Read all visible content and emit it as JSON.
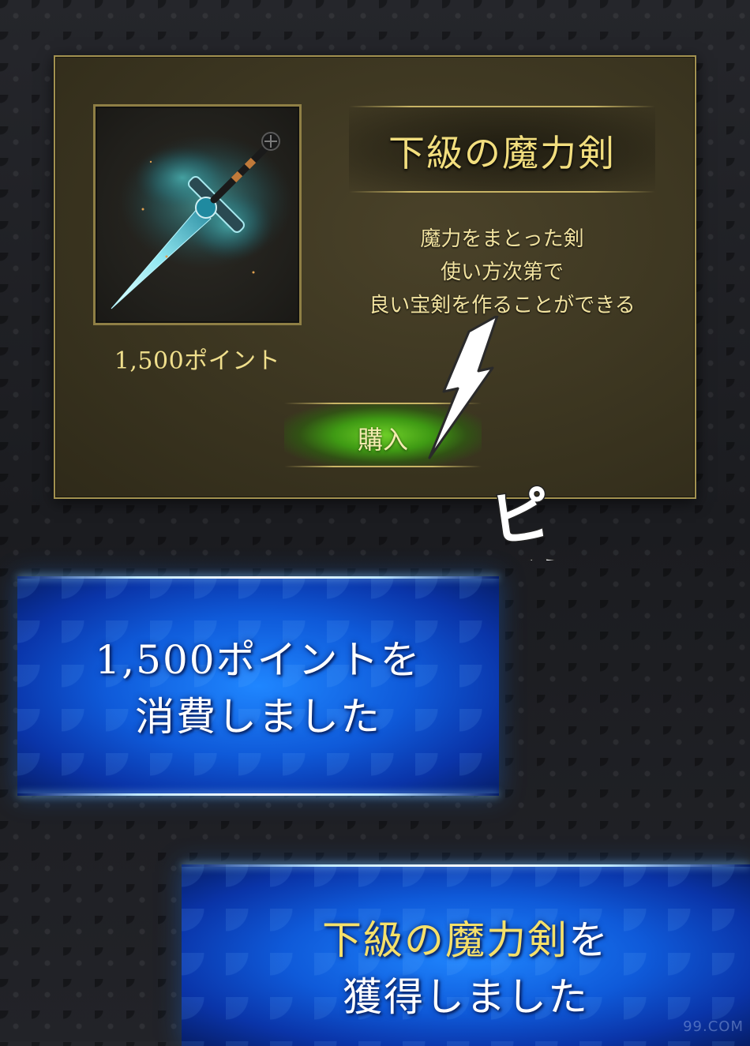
{
  "shop": {
    "item_name": "下級の魔力剣",
    "price": "1,500ポイント",
    "description": [
      "魔力をまとった剣",
      "使い方次第で",
      "良い宝剣を作ることができる"
    ],
    "buy_label": "購入",
    "item_icon": "sword-icon"
  },
  "sfx": {
    "sound_effect": "ピッ"
  },
  "banners": {
    "points_spent": {
      "line1": "1,500ポイントを",
      "line2": "消費しました"
    },
    "item_acquired": {
      "line1_item": "下級の魔力剣",
      "line1_suffix": "を",
      "line2": "獲得しました"
    }
  },
  "watermark": "99.COM",
  "colors": {
    "gold_text": "#f2de7e",
    "panel_border": "#a39250",
    "buy_glow": "#6fcf28",
    "banner_blue": "#0f5ad9"
  }
}
